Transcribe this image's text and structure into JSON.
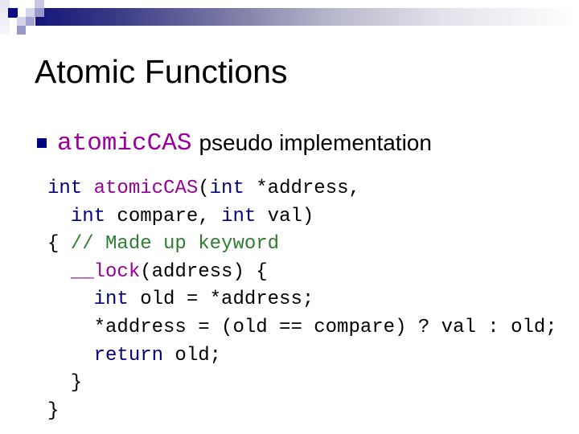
{
  "slide": {
    "title": "Atomic Functions",
    "bullet": {
      "code_term": "atomicCAS",
      "text": "pseudo implementation"
    },
    "code_lines": [
      [
        {
          "t": "int",
          "c": "kw"
        },
        {
          "t": " ",
          "c": ""
        },
        {
          "t": "atomicCAS",
          "c": "fn"
        },
        {
          "t": "(",
          "c": ""
        },
        {
          "t": "int",
          "c": "kw"
        },
        {
          "t": " *address,",
          "c": ""
        }
      ],
      [
        {
          "t": "  ",
          "c": ""
        },
        {
          "t": "int",
          "c": "kw"
        },
        {
          "t": " compare, ",
          "c": ""
        },
        {
          "t": "int",
          "c": "kw"
        },
        {
          "t": " val)",
          "c": ""
        }
      ],
      [
        {
          "t": "{ ",
          "c": ""
        },
        {
          "t": "// Made up keyword",
          "c": "cm"
        }
      ],
      [
        {
          "t": "  ",
          "c": ""
        },
        {
          "t": "__lock",
          "c": "fn"
        },
        {
          "t": "(address) {",
          "c": ""
        }
      ],
      [
        {
          "t": "    ",
          "c": ""
        },
        {
          "t": "int",
          "c": "kw"
        },
        {
          "t": " old = *address;",
          "c": ""
        }
      ],
      [
        {
          "t": "    *address = (old == compare) ? val : old;",
          "c": ""
        }
      ],
      [
        {
          "t": "    ",
          "c": ""
        },
        {
          "t": "return",
          "c": "kw"
        },
        {
          "t": " old;",
          "c": ""
        }
      ],
      [
        {
          "t": "  }",
          "c": ""
        }
      ],
      [
        {
          "t": "}",
          "c": ""
        }
      ]
    ],
    "colors": {
      "keyword": "#000080",
      "function": "#990099",
      "comment": "#2e7d32",
      "bullet": "#000080",
      "header_bar": "#15157a"
    }
  }
}
